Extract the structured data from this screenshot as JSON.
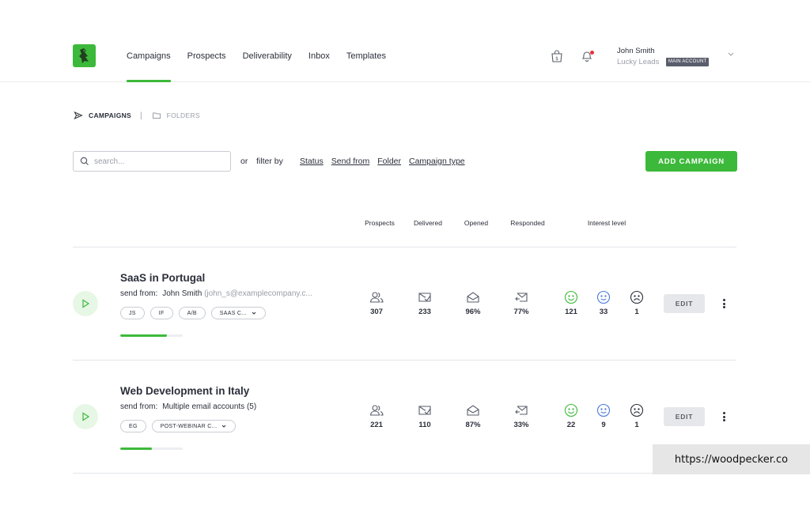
{
  "nav": {
    "items": [
      {
        "label": "Campaigns",
        "active": true
      },
      {
        "label": "Prospects",
        "active": false
      },
      {
        "label": "Deliverability",
        "active": false
      },
      {
        "label": "Inbox",
        "active": false
      },
      {
        "label": "Templates",
        "active": false
      }
    ]
  },
  "user": {
    "name": "John Smith",
    "company": "Lucky Leads",
    "badge": "MAIN ACCOUNT"
  },
  "breadcrumb": {
    "active": "CAMPAIGNS",
    "separator": "|",
    "folders": "FOLDERS"
  },
  "search": {
    "placeholder": "search...",
    "value": ""
  },
  "filters": {
    "or_label": "or",
    "by_label": "filter by",
    "links": [
      "Status",
      "Send from",
      "Folder",
      "Campaign type"
    ]
  },
  "add_button": "ADD CAMPAIGN",
  "columns": {
    "prospects": "Prospects",
    "delivered": "Delivered",
    "opened": "Opened",
    "responded": "Responded",
    "interest": "Interest level"
  },
  "campaigns": [
    {
      "name": "SaaS in Portugal",
      "send_from_label": "send from:",
      "sender": "John Smith",
      "sender_email": "(john_s@examplecompany.c...",
      "tags": [
        {
          "label": "JS",
          "dropdown": false
        },
        {
          "label": "IF",
          "dropdown": false
        },
        {
          "label": "A/B",
          "dropdown": false
        },
        {
          "label": "SAAS C...",
          "dropdown": true
        }
      ],
      "progress": 0.75,
      "prospects": "307",
      "delivered": "233",
      "opened": "96%",
      "responded": "77%",
      "interest_positive": "121",
      "interest_neutral": "33",
      "interest_negative": "1",
      "edit_label": "EDIT"
    },
    {
      "name": "Web Development in Italy",
      "send_from_label": "send from:",
      "sender": "Multiple email accounts (5)",
      "sender_email": "",
      "tags": [
        {
          "label": "EG",
          "dropdown": false
        },
        {
          "label": "POST-WEBINAR C...",
          "dropdown": true
        }
      ],
      "progress": 0.5,
      "prospects": "221",
      "delivered": "110",
      "opened": "87%",
      "responded": "33%",
      "interest_positive": "22",
      "interest_neutral": "9",
      "interest_negative": "1",
      "edit_label": "EDIT"
    }
  ],
  "watermark_url": "https://woodpecker.co",
  "colors": {
    "brand_green": "#3cb93a",
    "interest_positive": "#3cb93a",
    "interest_neutral": "#4a7bd8",
    "interest_negative": "#2b2f3a",
    "notification": "#e8323b"
  },
  "icons": {
    "logo": "woodpecker-logo-icon",
    "shop": "shopping-bag-dollar-icon",
    "notifications": "bell-icon",
    "campaigns_crumb": "send-icon",
    "folders_crumb": "folder-icon",
    "search": "search-icon",
    "prospects": "users-icon",
    "delivered": "mail-check-icon",
    "opened": "mail-open-icon",
    "responded": "mail-reply-icon"
  }
}
